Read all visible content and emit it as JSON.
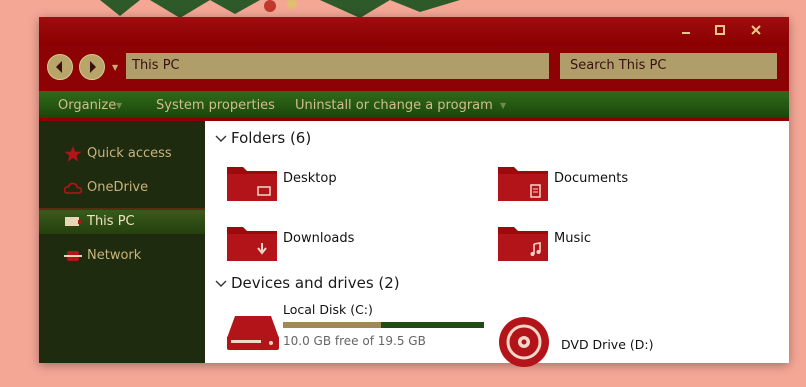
{
  "address": {
    "path": "This PC"
  },
  "search": {
    "placeholder": "Search This PC"
  },
  "ribbon": {
    "organize": "Organize",
    "system_properties": "System properties",
    "uninstall": "Uninstall or change a program"
  },
  "sidebar": {
    "items": [
      {
        "label": "Quick access",
        "icon": "star-icon"
      },
      {
        "label": "OneDrive",
        "icon": "cloud-icon"
      },
      {
        "label": "This PC",
        "icon": "computer-icon",
        "selected": true
      },
      {
        "label": "Network",
        "icon": "network-icon"
      }
    ]
  },
  "folders": {
    "heading": "Folders (6)",
    "items": [
      {
        "name": "Desktop",
        "icon": "desktop-folder-icon"
      },
      {
        "name": "Documents",
        "icon": "documents-folder-icon"
      },
      {
        "name": "Downloads",
        "icon": "downloads-folder-icon"
      },
      {
        "name": "Music",
        "icon": "music-folder-icon"
      }
    ]
  },
  "devices": {
    "heading": "Devices and drives (2)",
    "drives": [
      {
        "name": "Local Disk (C:)",
        "free_text": "10.0 GB free of 19.5 GB",
        "used_fraction": 0.49,
        "icon": "hard-drive-icon"
      },
      {
        "name": "DVD Drive (D:)",
        "icon": "dvd-drive-icon"
      }
    ]
  },
  "colors": {
    "window_red": "#8b0000",
    "ribbon_green": "#2f6a1c",
    "sidebar_dark": "#1f2b0e",
    "gold": "#b09e6a"
  }
}
